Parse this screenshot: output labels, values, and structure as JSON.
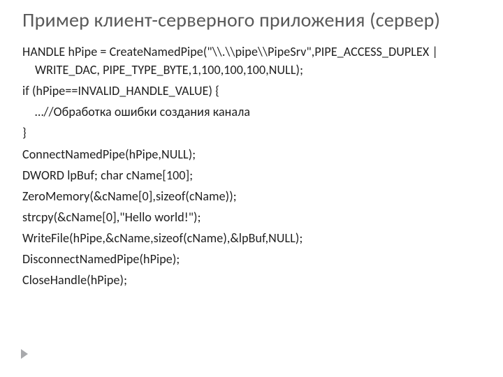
{
  "title": "Пример клиент-серверного приложения (сервер)",
  "code": {
    "l1": "HANDLE hPipe = CreateNamedPipe(\"\\\\.\\\\pipe\\\\PipeSrv\",PIPE_ACCESS_DUPLEX | WRITE_DAC, PIPE_TYPE_BYTE,1,100,100,100,NULL);",
    "l2": "if (hPipe==INVALID_HANDLE_VALUE) {",
    "l3": "…//Обработка ошибки создания канала",
    "l4": "}",
    "l5": "ConnectNamedPipe(hPipe,NULL);",
    "l6": "DWORD lpBuf; char cName[100];",
    "l7": "ZeroMemory(&cName[0],sizeof(cName));",
    "l8": "strcpy(&cName[0],\"Hello world!\");",
    "l9": "WriteFile(hPipe,&cName,sizeof(cName),&lpBuf,NULL);",
    "l10": "DisconnectNamedPipe(hPipe);",
    "l11": "CloseHandle(hPipe);"
  }
}
